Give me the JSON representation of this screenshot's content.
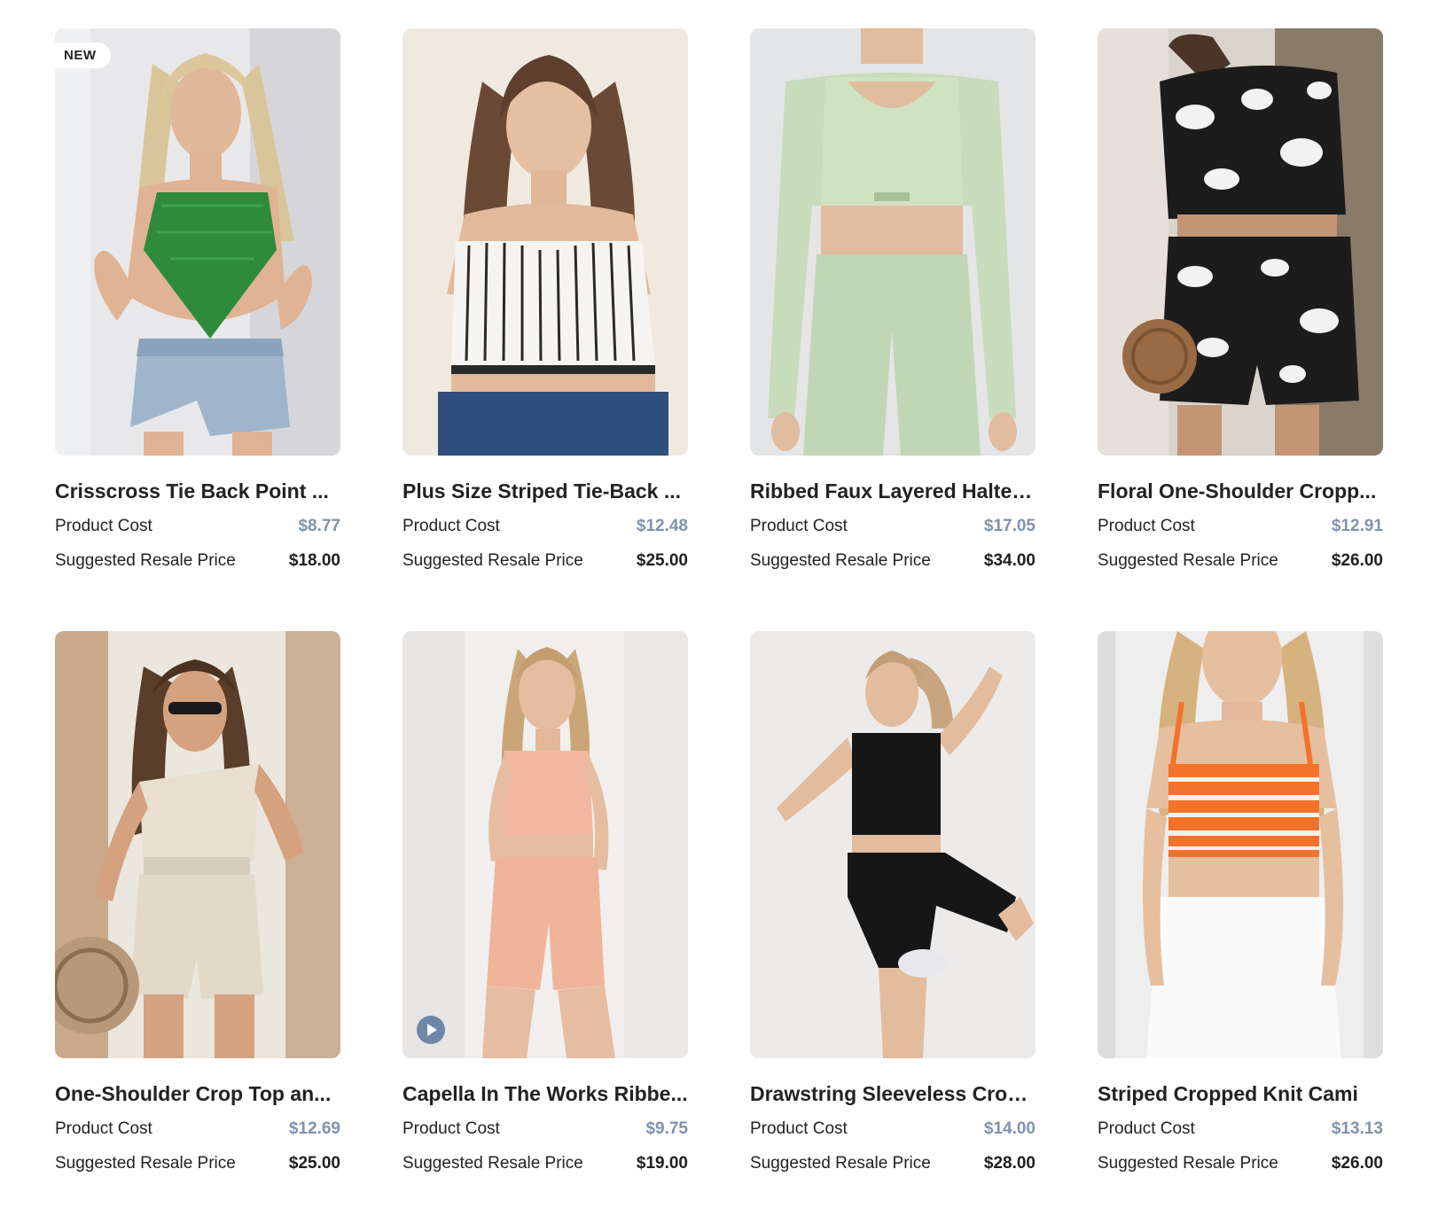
{
  "labels": {
    "product_cost": "Product Cost",
    "suggested_resale": "Suggested Resale Price"
  },
  "products": [
    {
      "title": "Crisscross Tie Back Point Hem Lace Cami Top",
      "display_title": "Crisscross Tie Back Point ...",
      "cost": "$8.77",
      "resale": "$18.00",
      "badge": "NEW",
      "image": "woman-green-lace-cami-denim-shorts"
    },
    {
      "title": "Plus Size Striped Tie-Back Cami Top",
      "display_title": "Plus Size Striped Tie-Back ...",
      "cost": "$12.48",
      "resale": "$25.00",
      "image": "woman-striped-cami-jeans"
    },
    {
      "title": "Ribbed Faux Layered Halter Top",
      "display_title": "Ribbed Faux Layered Halter...",
      "cost": "$17.05",
      "resale": "$34.00",
      "image": "woman-mint-longsleeve-leggings"
    },
    {
      "title": "Floral One-Shoulder Cropped Top and Shorts Set",
      "display_title": "Floral One-Shoulder Cropp...",
      "cost": "$12.91",
      "resale": "$26.00",
      "image": "woman-black-floral-set"
    },
    {
      "title": "One-Shoulder Crop Top and Shorts Set",
      "display_title": "One-Shoulder Crop Top an...",
      "cost": "$12.69",
      "resale": "$25.00",
      "image": "woman-beige-one-shoulder-set"
    },
    {
      "title": "Capella In The Works Ribbed Set",
      "display_title": "Capella In The Works Ribbe...",
      "cost": "$9.75",
      "resale": "$19.00",
      "has_video": true,
      "image": "woman-peach-ribbed-set"
    },
    {
      "title": "Drawstring Sleeveless Cropped Top",
      "display_title": "Drawstring Sleeveless Crop...",
      "cost": "$14.00",
      "resale": "$28.00",
      "image": "woman-black-activewear"
    },
    {
      "title": "Striped Cropped Knit Cami",
      "display_title": "Striped Cropped Knit Cami",
      "cost": "$13.13",
      "resale": "$26.00",
      "image": "woman-orange-striped-cami"
    }
  ],
  "colors": {
    "cost_price": "#7f93ab",
    "text": "#222222",
    "play_button": "#6e87a8"
  },
  "icons": {
    "video": "play-icon"
  }
}
